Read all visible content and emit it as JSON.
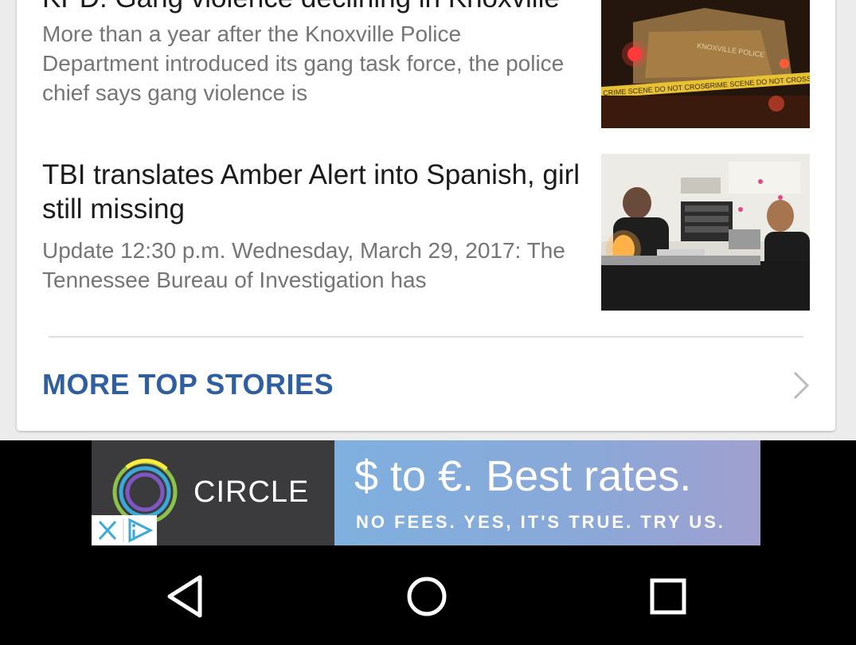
{
  "stories": [
    {
      "title": "KPD: Gang violence declining in Knoxville",
      "summary": "More than a year after the Knoxville Police Department introduced its gang task force, the police chief says gang violence is",
      "thumbnail_text": [
        "KNOXVILLE POLICE",
        "CRIME SCENE DO NOT CROSS",
        "CRIME SCENE DO NOT CROSS"
      ]
    },
    {
      "title": "TBI translates Amber Alert into Spanish, girl still missing",
      "summary": "Update 12:30 p.m. Wednesday, March 29, 2017: The Tennessee Bureau of Investigation has"
    }
  ],
  "more_top_stories": {
    "label": "MORE TOP STORIES",
    "icon": "chevron-right-icon"
  },
  "ad": {
    "brand": "CIRCLE",
    "headline": "$ to €. Best rates.",
    "subline": "NO FEES. YES, IT'S TRUE. TRY US.",
    "icons": [
      "close-icon",
      "adchoices-icon",
      "circle-logo-icon"
    ]
  },
  "nav": {
    "icons": [
      "back-icon",
      "home-icon",
      "recents-icon"
    ]
  },
  "colors": {
    "link_blue": "#2f5fa0",
    "summary_gray": "#757575",
    "adchoices_blue": "#3aa8d8"
  }
}
